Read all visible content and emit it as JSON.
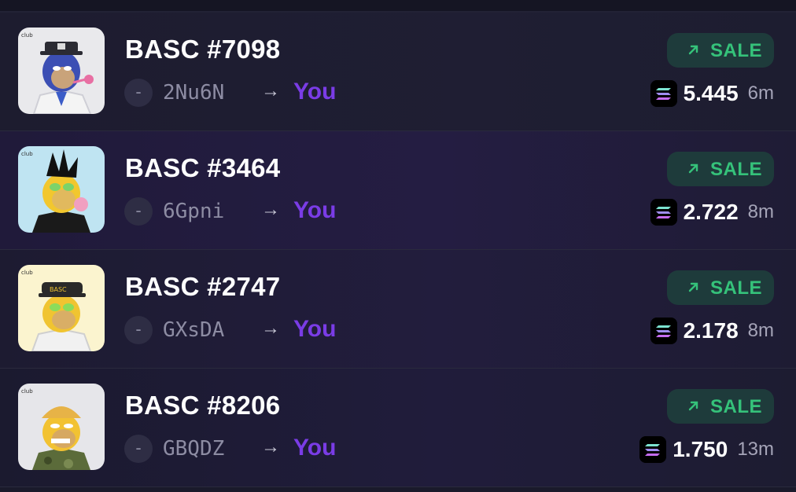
{
  "colors": {
    "background": "#1a1a2b",
    "accent_you": "#7a3ce6",
    "sale_green": "#35c27a",
    "sale_pill_bg": "#1e3b3b"
  },
  "icons": {
    "sale": "arrow-up-right-icon",
    "currency": "solana-icon",
    "transfer": "right-arrow-icon"
  },
  "sales": [
    {
      "title": "BASC #7098",
      "from_badge": "-",
      "from": "2Nu6N",
      "arrow": "→",
      "to": "You",
      "type": "SALE",
      "price": "5.445",
      "age": "6m"
    },
    {
      "title": "BASC #3464",
      "from_badge": "-",
      "from": "6Gpni",
      "arrow": "→",
      "to": "You",
      "type": "SALE",
      "price": "2.722",
      "age": "8m"
    },
    {
      "title": "BASC #2747",
      "from_badge": "-",
      "from": "GXsDA",
      "arrow": "→",
      "to": "You",
      "type": "SALE",
      "price": "2.178",
      "age": "8m"
    },
    {
      "title": "BASC #8206",
      "from_badge": "-",
      "from": "GBQDZ",
      "arrow": "→",
      "to": "You",
      "type": "SALE",
      "price": "1.750",
      "age": "13m"
    }
  ]
}
